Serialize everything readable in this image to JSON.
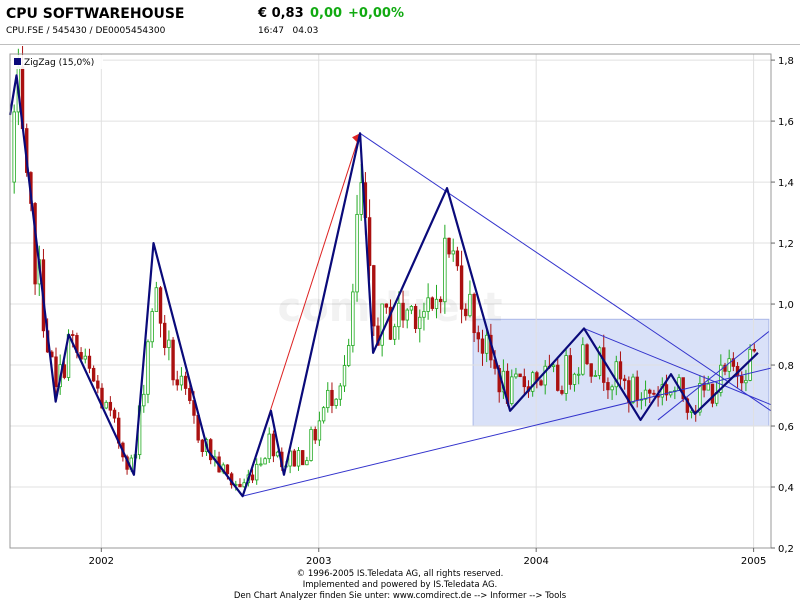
{
  "header": {
    "title": "CPU SOFTWAREHOUSE",
    "subtitle": "CPU.FSE  /  545430  /  DE0005454300",
    "price": "€ 0,83",
    "change_abs": "0,00",
    "change_pct": "+0,00%",
    "time": "16:47",
    "date": "04.03"
  },
  "footer": {
    "line1": "© 1996-2005 IS.Teledata AG, all rights reserved.",
    "line2": "Implemented and powered by IS.Teledata AG.",
    "line3": "Den Chart Analyzer finden Sie unter: www.comdirect.de --> Informer --> Tools"
  },
  "watermark": "comdirect",
  "colors": {
    "zigzag": "#0a0a7a",
    "trend": "#3333cc",
    "red_trend": "#dd2222",
    "up_candle": "#22aa22",
    "down_candle": "#aa1111",
    "channel_fill": "#ccd7f5"
  },
  "chart_data": {
    "type": "candlestick",
    "indicator_label": "ZigZag (15,0%)",
    "x_ticks": [
      "2002",
      "2003",
      "2004",
      "2005"
    ],
    "x_tick_pos": [
      2002.0,
      2003.0,
      2004.0,
      2005.0
    ],
    "y_ticks": [
      "0,2",
      "0,4",
      "0,6",
      "0,8",
      "1,0",
      "1,2",
      "1,4",
      "1,6",
      "1,8"
    ],
    "y_tick_vals": [
      0.2,
      0.4,
      0.6,
      0.8,
      1.0,
      1.2,
      1.4,
      1.6,
      1.8
    ],
    "xlim": [
      2001.58,
      2005.08
    ],
    "ylim": [
      0.2,
      1.82
    ],
    "grid": true,
    "zigzag": [
      [
        2001.58,
        1.62
      ],
      [
        2001.61,
        1.75
      ],
      [
        2001.79,
        0.68
      ],
      [
        2001.85,
        0.9
      ],
      [
        2002.15,
        0.44
      ],
      [
        2002.24,
        1.2
      ],
      [
        2002.49,
        0.52
      ],
      [
        2002.65,
        0.37
      ],
      [
        2002.78,
        0.65
      ],
      [
        2002.84,
        0.44
      ],
      [
        2003.19,
        1.56
      ],
      [
        2003.25,
        0.84
      ],
      [
        2003.59,
        1.38
      ],
      [
        2003.88,
        0.65
      ],
      [
        2004.22,
        0.92
      ],
      [
        2004.48,
        0.62
      ],
      [
        2004.62,
        0.77
      ],
      [
        2004.73,
        0.64
      ],
      [
        2005.02,
        0.84
      ]
    ],
    "red_trend": [
      [
        2002.65,
        0.37
      ],
      [
        2003.19,
        1.56
      ]
    ],
    "trend_lines": [
      [
        [
          2002.65,
          0.37
        ],
        [
          2005.08,
          0.79
        ]
      ],
      [
        [
          2003.19,
          1.56
        ],
        [
          2005.08,
          0.65
        ]
      ],
      [
        [
          2004.22,
          0.92
        ],
        [
          2005.08,
          0.67
        ]
      ],
      [
        [
          2004.56,
          0.62
        ],
        [
          2005.07,
          0.91
        ]
      ]
    ],
    "channel": {
      "x": [
        2003.71,
        2005.07
      ],
      "y": [
        0.6,
        0.95
      ]
    },
    "series_anchors": [
      [
        2001.58,
        1.4
      ],
      [
        2001.61,
        1.72
      ],
      [
        2001.66,
        1.3
      ],
      [
        2001.72,
        1.05
      ],
      [
        2001.79,
        0.7
      ],
      [
        2001.85,
        0.88
      ],
      [
        2001.98,
        0.72
      ],
      [
        2002.1,
        0.52
      ],
      [
        2002.15,
        0.46
      ],
      [
        2002.24,
        1.05
      ],
      [
        2002.32,
        0.8
      ],
      [
        2002.42,
        0.62
      ],
      [
        2002.49,
        0.52
      ],
      [
        2002.59,
        0.42
      ],
      [
        2002.65,
        0.4
      ],
      [
        2002.78,
        0.56
      ],
      [
        2002.84,
        0.48
      ],
      [
        2002.95,
        0.52
      ],
      [
        2003.05,
        0.7
      ],
      [
        2003.14,
        0.82
      ],
      [
        2003.19,
        1.4
      ],
      [
        2003.25,
        0.92
      ],
      [
        2003.35,
        0.95
      ],
      [
        2003.45,
        1.0
      ],
      [
        2003.52,
        0.94
      ],
      [
        2003.59,
        1.2
      ],
      [
        2003.68,
        1.02
      ],
      [
        2003.78,
        0.82
      ],
      [
        2003.88,
        0.7
      ],
      [
        2003.98,
        0.77
      ],
      [
        2004.1,
        0.74
      ],
      [
        2004.22,
        0.85
      ],
      [
        2004.33,
        0.78
      ],
      [
        2004.42,
        0.72
      ],
      [
        2004.48,
        0.7
      ],
      [
        2004.6,
        0.73
      ],
      [
        2004.73,
        0.68
      ],
      [
        2004.85,
        0.75
      ],
      [
        2005.02,
        0.84
      ]
    ]
  }
}
